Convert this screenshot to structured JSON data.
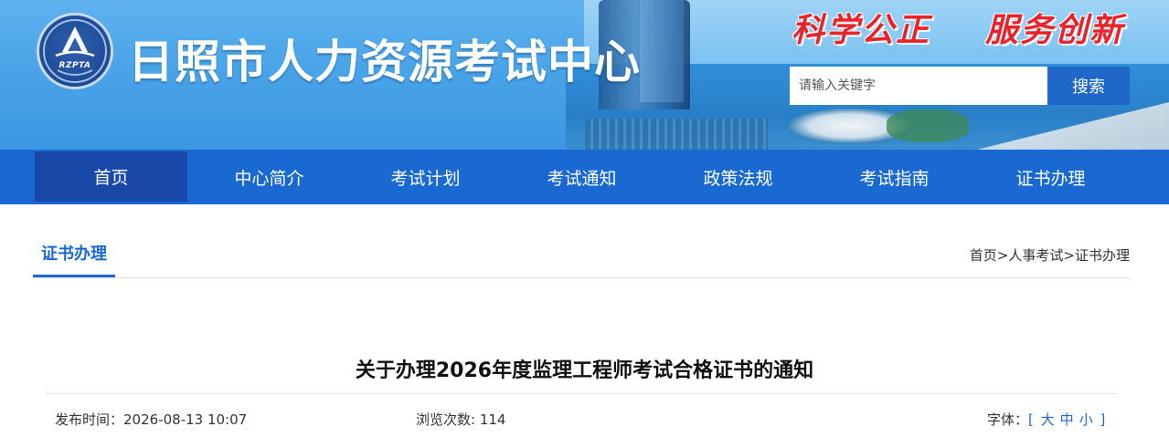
{
  "header": {
    "logo_text": "RZPTA",
    "site_title": "日照市人力资源考试中心",
    "slogan_left": "科学公正",
    "slogan_right": "服务创新",
    "search": {
      "placeholder": "请输入关键字",
      "button_label": "搜索"
    }
  },
  "nav": {
    "items": [
      {
        "label": "首页",
        "active": true
      },
      {
        "label": "中心简介"
      },
      {
        "label": "考试计划"
      },
      {
        "label": "考试通知"
      },
      {
        "label": "政策法规"
      },
      {
        "label": "考试指南"
      },
      {
        "label": "证书办理"
      }
    ]
  },
  "section": {
    "tab_label": "证书办理",
    "breadcrumb": {
      "home": "首页",
      "sep": ">",
      "level1": "人事考试",
      "level2": "证书办理"
    }
  },
  "article": {
    "title": "关于办理2026年度监理工程师考试合格证书的通知",
    "publish_label": "发布时间：",
    "publish_time": "2026-08-13 10:07",
    "views_label": "浏览次数: ",
    "views": "114",
    "font_label": "字体：",
    "bracket_open": "[",
    "bracket_close": "]",
    "font_sizes": [
      "大",
      "中",
      "小"
    ]
  },
  "colors": {
    "nav_bg": "#1a68d1",
    "nav_active": "#1a48a8",
    "slogan": "#e8232b",
    "accent": "#1a68d1"
  }
}
